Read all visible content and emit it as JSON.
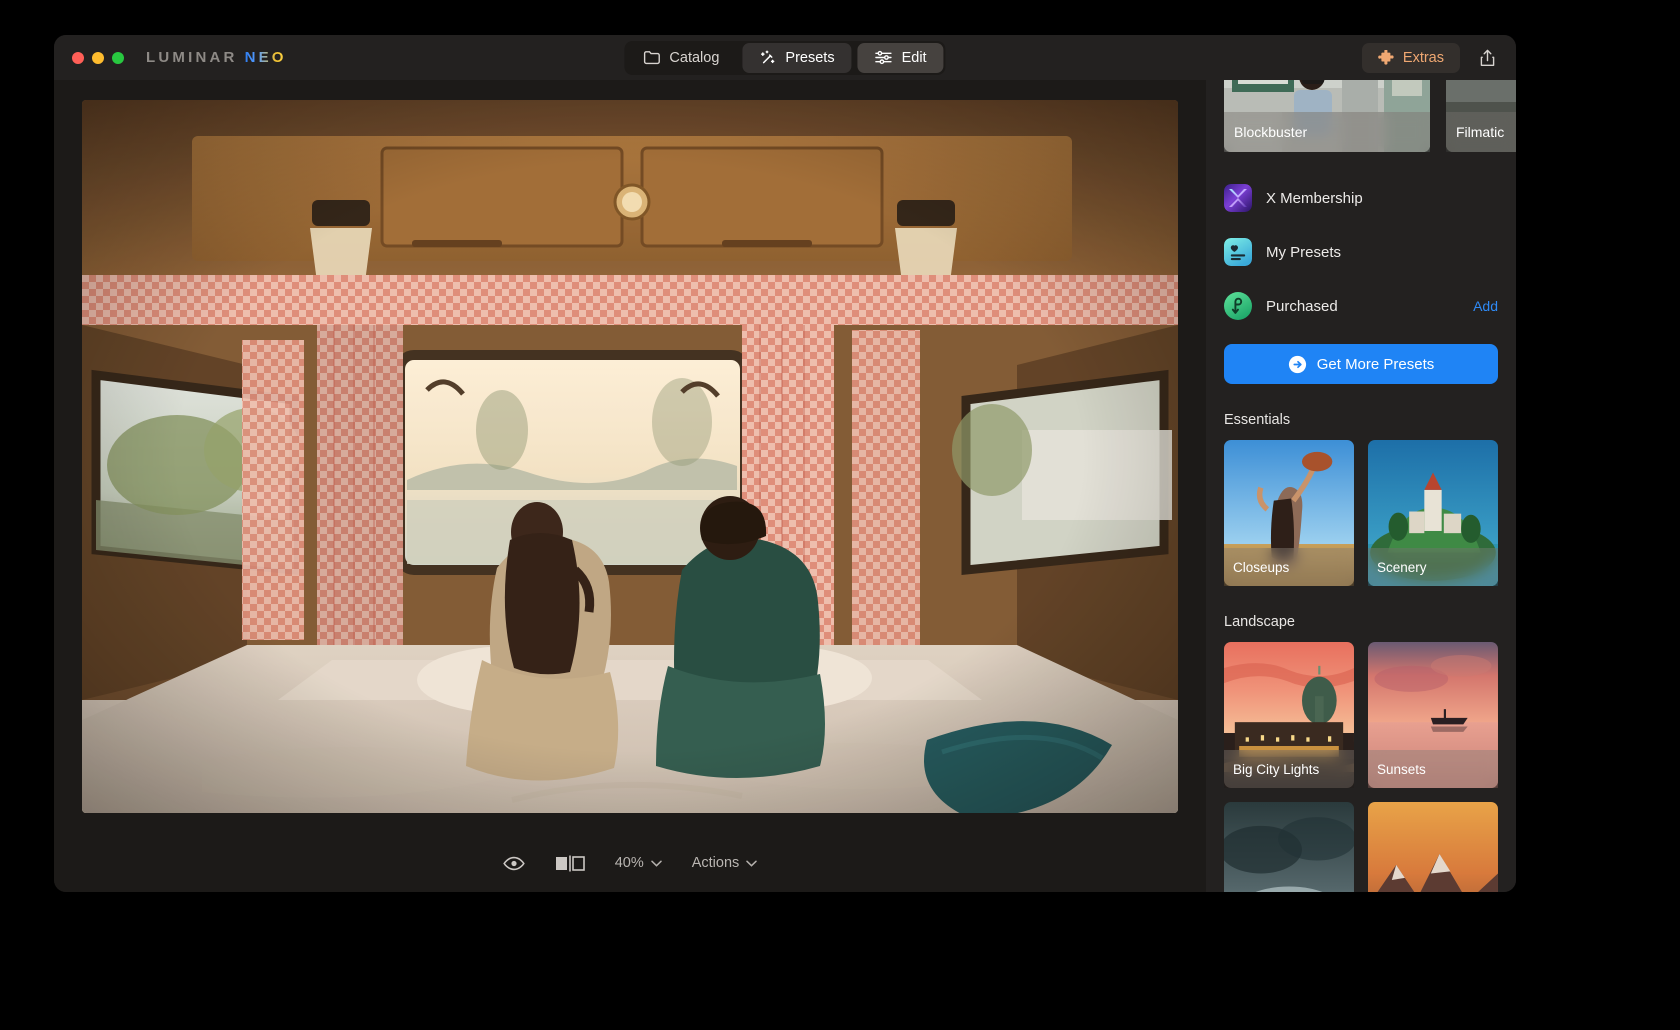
{
  "window": {
    "traffic_lights": [
      "close",
      "minimize",
      "maximize"
    ],
    "brand_primary": "LUMINAR",
    "brand_secondary": "NEO"
  },
  "toolbar": {
    "tabs": [
      {
        "label": "Catalog",
        "icon": "folder-icon",
        "active": false
      },
      {
        "label": "Presets",
        "icon": "magic-wand-icon",
        "active": true
      },
      {
        "label": "Edit",
        "icon": "sliders-icon",
        "active": false
      }
    ],
    "extras_label": "Extras",
    "extras_icon": "puzzle-piece-icon",
    "share_icon": "share-icon"
  },
  "bottom_bar": {
    "preview_icon": "eye-icon",
    "compare_icon": "before-after-icon",
    "zoom_level": "40%",
    "zoom_caret": "chevron-down-icon",
    "actions_label": "Actions",
    "actions_caret": "chevron-down-icon"
  },
  "panel": {
    "top_thumbnails": [
      {
        "label": "Blockbuster"
      },
      {
        "label": "Filmatic"
      }
    ],
    "menu_items": [
      {
        "label": "X Membership",
        "icon": "x-membership-icon",
        "action": null
      },
      {
        "label": "My Presets",
        "icon": "my-presets-icon",
        "action": null
      },
      {
        "label": "Purchased",
        "icon": "purchased-icon",
        "action": "Add"
      }
    ],
    "get_more_label": "Get More Presets",
    "get_more_icon": "arrow-right-circle-icon",
    "sections": [
      {
        "title": "Essentials",
        "presets": [
          {
            "label": "Closeups"
          },
          {
            "label": "Scenery"
          }
        ]
      },
      {
        "title": "Landscape",
        "presets": [
          {
            "label": "Big City Lights"
          },
          {
            "label": "Sunsets"
          },
          {
            "label": ""
          },
          {
            "label": ""
          }
        ]
      }
    ]
  },
  "canvas": {
    "image_description": "Couple sitting on a bed inside a camper van looking out the rear window at a lake at sunset"
  },
  "colors": {
    "accent_blue": "#1f84f5",
    "extras_orange": "#f0a872",
    "window_bg": "#1c1a18",
    "panel_bg": "#232120",
    "titlebar_bg": "#232120"
  }
}
